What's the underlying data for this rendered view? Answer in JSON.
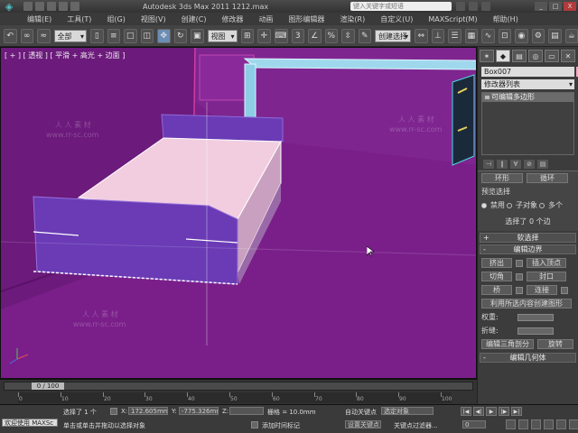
{
  "titlebar": {
    "window_title": "Autodesk 3ds Max  2011    1212.max",
    "search_placeholder": "键入关键字或短语",
    "minimize": "_",
    "maximize": "□",
    "close": "X"
  },
  "menubar": [
    "编辑(E)",
    "工具(T)",
    "组(G)",
    "视图(V)",
    "创建(C)",
    "修改器",
    "动画",
    "图形编辑器",
    "渲染(R)",
    "自定义(U)",
    "MAXScript(M)",
    "帮助(H)"
  ],
  "toolbar": {
    "selection_filter": "全部",
    "view_dropdown": "视图",
    "named_set_label": "创建选择集"
  },
  "viewport": {
    "label": "[ + ] [ 透视 ] [ 平滑 + 高光 + 边面 ]",
    "colors": {
      "background": "#7a1f8a",
      "bed_frame": "#6a3bb5",
      "mattress": "#f2cde0",
      "desk": "#8fd0e8"
    },
    "watermarks": [
      "人 人 素 材",
      "www.rr-sc.com",
      "人 人 素 材",
      "www.rr-sc.com",
      "人 人 素 材",
      "www.rr-sc.com"
    ]
  },
  "command_panel": {
    "object_name": "Box007",
    "object_color": "#f4a6c8",
    "modifier_list": "修改器列表",
    "stack_item": "可编辑多边形",
    "ring_label": "环形",
    "loop_label": "循环",
    "preview_label": "预览选择",
    "preview_options": [
      "禁用",
      "子对象",
      "多个"
    ],
    "selection_status": "选择了 0 个边",
    "soft_selection": "软选择",
    "edit_edges": "编辑边界",
    "extrude": "挤出",
    "insert_vertex": "插入顶点",
    "chamfer": "切角",
    "cap": "封口",
    "bridge": "桥",
    "connect": "连接",
    "create_shape": "利用所选内容创建图形",
    "weight": "权重:",
    "crease": "折缝:",
    "edit_tri": "编辑三角剖分",
    "rotate": "旋转",
    "edit_geometry": "编辑几何体"
  },
  "timeline": {
    "frame_display": "0 / 100",
    "ticks": [
      "0",
      "10",
      "20",
      "30",
      "40",
      "50",
      "60",
      "70",
      "80",
      "90",
      "100"
    ]
  },
  "statusbar": {
    "maxscript_label": "欢迎使用 MAXSc",
    "selection_info": "选择了 1 个",
    "prompt": "单击或单击并拖动以选择对象",
    "x_label": "X:",
    "x_value": "172.605mm",
    "y_label": "Y:",
    "y_value": "-775.326mm",
    "z_label": "Z:",
    "grid": "栅格 = 10.0mm",
    "autokey": "自动关键点",
    "selected_obj": "选定对象",
    "setkey": "设置关键点",
    "keyfilter": "关键点过滤器...",
    "add_time_tag": "添加时间标记",
    "frame_num": "0"
  }
}
